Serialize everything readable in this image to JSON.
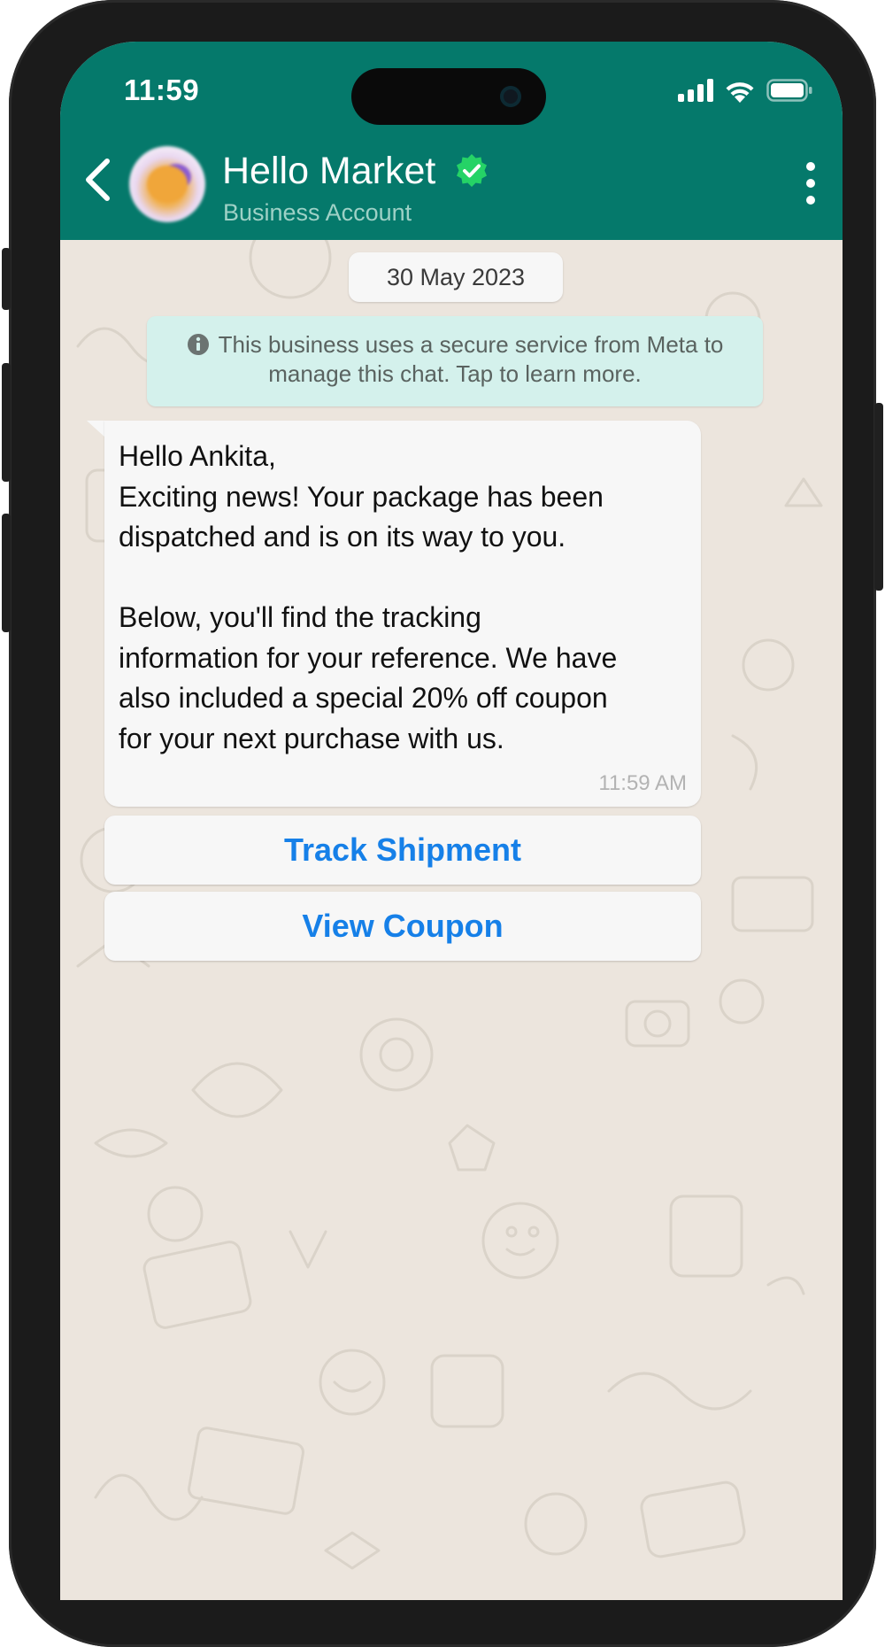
{
  "status_bar": {
    "time": "11:59",
    "icons": [
      "cellular-signal-icon",
      "wifi-icon",
      "battery-icon"
    ]
  },
  "header": {
    "back_icon": "chevron-left-icon",
    "contact_name": "Hello Market",
    "verified_icon": "verified-badge-icon",
    "subtitle": "Business Account",
    "menu_icon": "more-vertical-icon"
  },
  "chat": {
    "date": "30 May 2023",
    "notice": "This business uses a secure service from Meta to manage this chat. Tap to learn more.",
    "notice_line1": "This business uses a secure service from Meta to",
    "notice_line2": "manage this chat. Tap to learn more.",
    "message": {
      "lines": [
        "Hello Ankita,",
        "Exciting news! Your package has been",
        "dispatched and is on its way to you.",
        "",
        "Below, you'll find the tracking",
        "information for your reference. We have",
        "also included a special 20% off coupon",
        "for your next purchase with us."
      ],
      "time": "11:59 AM"
    },
    "buttons": [
      {
        "label": "Track Shipment"
      },
      {
        "label": "View Coupon"
      }
    ]
  },
  "colors": {
    "header_green": "#05796b",
    "chat_background": "#ece5dd",
    "notice_background": "#d4f1ec",
    "button_text": "#1680e8",
    "verified_green": "#25d366"
  }
}
